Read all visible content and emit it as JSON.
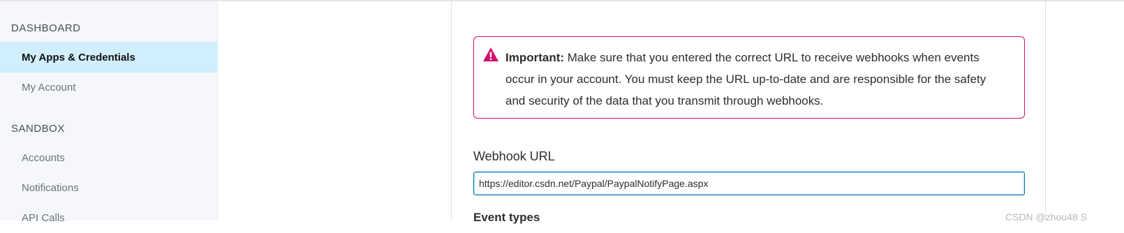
{
  "sidebar": {
    "dashboard_title": "DASHBOARD",
    "dashboard_items": [
      {
        "label": "My Apps & Credentials",
        "active": true
      },
      {
        "label": "My Account",
        "active": false
      }
    ],
    "sandbox_title": "SANDBOX",
    "sandbox_items": [
      {
        "label": "Accounts"
      },
      {
        "label": "Notifications"
      },
      {
        "label": "API Calls"
      }
    ]
  },
  "alert": {
    "icon": "warning-triangle-icon",
    "color": "#d20f6a",
    "bold_label": "Important:",
    "message": " Make sure that you entered the correct URL to receive webhooks when events occur in your account. You must keep the URL up-to-date and are responsible for the safety and security of the data that you transmit through webhooks."
  },
  "webhook": {
    "label": "Webhook URL",
    "value": "https://editor.csdn.net/Paypal/PaypalNotifyPage.aspx"
  },
  "event_types": {
    "label": "Event types"
  },
  "watermark": "CSDN @zhou48 S"
}
